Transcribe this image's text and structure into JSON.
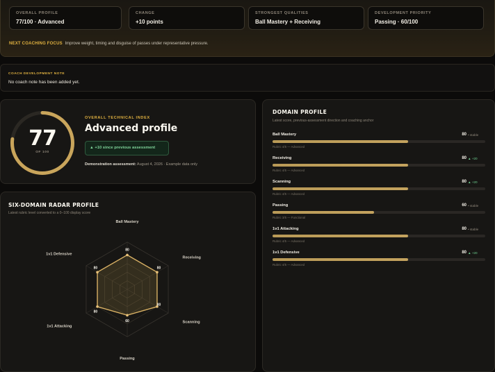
{
  "summary": {
    "cards": [
      {
        "label": "OVERALL PROFILE",
        "value": "77/100 · Advanced"
      },
      {
        "label": "CHANGE",
        "value": "+10 points"
      },
      {
        "label": "STRONGEST QUALITIES",
        "value": "Ball Mastery + Receiving"
      },
      {
        "label": "DEVELOPMENT PRIORITY",
        "value": "Passing · 60/100"
      }
    ],
    "focus_label": "NEXT COACHING FOCUS",
    "focus_text": "Improve weight, timing and disguise of passes under representative pressure."
  },
  "coach_note": {
    "label": "COACH DEVELOPMENT NOTE",
    "text": "No coach note has been added yet."
  },
  "score": {
    "value": "77",
    "fraction": 0.77,
    "of_label": "OF 100",
    "index_label": "OVERALL TECHNICAL INDEX",
    "profile_title": "Advanced profile",
    "change_text": "▲ +10 since previous assessment",
    "demo_label": "Demonstration assessment:",
    "demo_detail": "August 4, 2026 · Example data only"
  },
  "radar": {
    "title": "SIX-DOMAIN RADAR PROFILE",
    "subtitle": "Latest rubric level converted to a 0–100 display score",
    "max": 100,
    "axes": [
      {
        "label": "Ball Mastery",
        "value": 80
      },
      {
        "label": "Receiving",
        "value": 80
      },
      {
        "label": "Scanning",
        "value": 80
      },
      {
        "label": "Passing",
        "value": 60
      },
      {
        "label": "1v1 Attacking",
        "value": 80
      },
      {
        "label": "1v1 Defensive",
        "value": 80
      }
    ]
  },
  "domain_profile": {
    "title": "DOMAIN PROFILE",
    "subtitle": "Latest score, previous-assessment direction and coaching anchor",
    "items": [
      {
        "name": "Ball Mastery",
        "score": "80",
        "value": 80,
        "trend": "• stable",
        "up": false,
        "note": "Rubric 4/5 — Advanced"
      },
      {
        "name": "Receiving",
        "score": "80",
        "value": 80,
        "trend": "▲ +20",
        "up": true,
        "note": "Rubric 4/5 — Advanced"
      },
      {
        "name": "Scanning",
        "score": "80",
        "value": 80,
        "trend": "▲ +20",
        "up": true,
        "note": "Rubric 4/5 — Advanced"
      },
      {
        "name": "Passing",
        "score": "60",
        "value": 60,
        "trend": "• stable",
        "up": false,
        "note": "Rubric 3/5 — Functional"
      },
      {
        "name": "1v1 Attacking",
        "score": "80",
        "value": 80,
        "trend": "• stable",
        "up": false,
        "note": "Rubric 4/5 — Advanced"
      },
      {
        "name": "1v1 Defensive",
        "score": "80",
        "value": 80,
        "trend": "▲ +20",
        "up": true,
        "note": "Rubric 4/5 — Advanced"
      }
    ]
  },
  "colors": {
    "accent": "#e3b341",
    "gold": "#c4a35e",
    "positive": "#6fd091"
  }
}
